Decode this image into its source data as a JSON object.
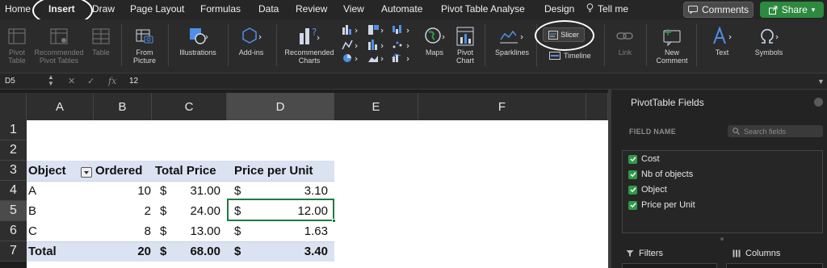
{
  "menu": {
    "home": "Home",
    "insert": "Insert",
    "draw": "Draw",
    "page_layout": "Page Layout",
    "formulas": "Formulas",
    "data": "Data",
    "review": "Review",
    "view": "View",
    "automate": "Automate",
    "pivot_table_analyse": "Pivot Table Analyse",
    "design": "Design",
    "tell_me": "Tell me",
    "comments": "Comments",
    "share": "Share"
  },
  "ribbon": {
    "pivot_table": "Pivot\nTable",
    "recommended_pivot_tables": "Recommended\nPivot Tables",
    "table": "Table",
    "from_picture": "From\nPicture",
    "illustrations": "Illustrations",
    "add_ins": "Add-ins",
    "recommended_charts": "Recommended\nCharts",
    "maps": "Maps",
    "pivot_chart": "Pivot\nChart",
    "sparklines": "Sparklines",
    "slicer": "Slicer",
    "timeline": "Timeline",
    "link": "Link",
    "new_comment": "New\nComment",
    "text": "Text",
    "symbols": "Symbols"
  },
  "formula_bar": {
    "cell_ref": "D5",
    "fx": "fx",
    "value": "12"
  },
  "sheet": {
    "columns": [
      "A",
      "B",
      "C",
      "D",
      "E",
      "F"
    ],
    "selected_column": "D",
    "rows": [
      "1",
      "2",
      "3",
      "4",
      "5",
      "6",
      "7"
    ],
    "selected_row": "5",
    "pivot": {
      "headers": [
        "Object",
        "Ordered",
        "Total Price",
        "Price per Unit"
      ],
      "rows": [
        {
          "object": "A",
          "ordered": "10",
          "cur1": "$",
          "total": "31.00",
          "cur2": "$",
          "ppu": "3.10"
        },
        {
          "object": "B",
          "ordered": "2",
          "cur1": "$",
          "total": "24.00",
          "cur2": "$",
          "ppu": "12.00"
        },
        {
          "object": "C",
          "ordered": "8",
          "cur1": "$",
          "total": "13.00",
          "cur2": "$",
          "ppu": "1.63"
        }
      ],
      "total": {
        "object": "Total",
        "ordered": "20",
        "cur1": "$",
        "total": "68.00",
        "cur2": "$",
        "ppu": "3.40"
      }
    }
  },
  "pivot_panel": {
    "title": "PivotTable Fields",
    "field_name": "FIELD NAME",
    "search_placeholder": "Search fields",
    "fields": [
      "Cost",
      "Nb of objects",
      "Object",
      "Price per Unit"
    ],
    "filters": "Filters",
    "columns": "Columns"
  },
  "colors": {
    "accent_green": "#2c8a3e",
    "selection_green": "#1e7a41",
    "pivot_band": "#dbe2f1",
    "ribbon_icon_blue": "#4f8fe6"
  }
}
